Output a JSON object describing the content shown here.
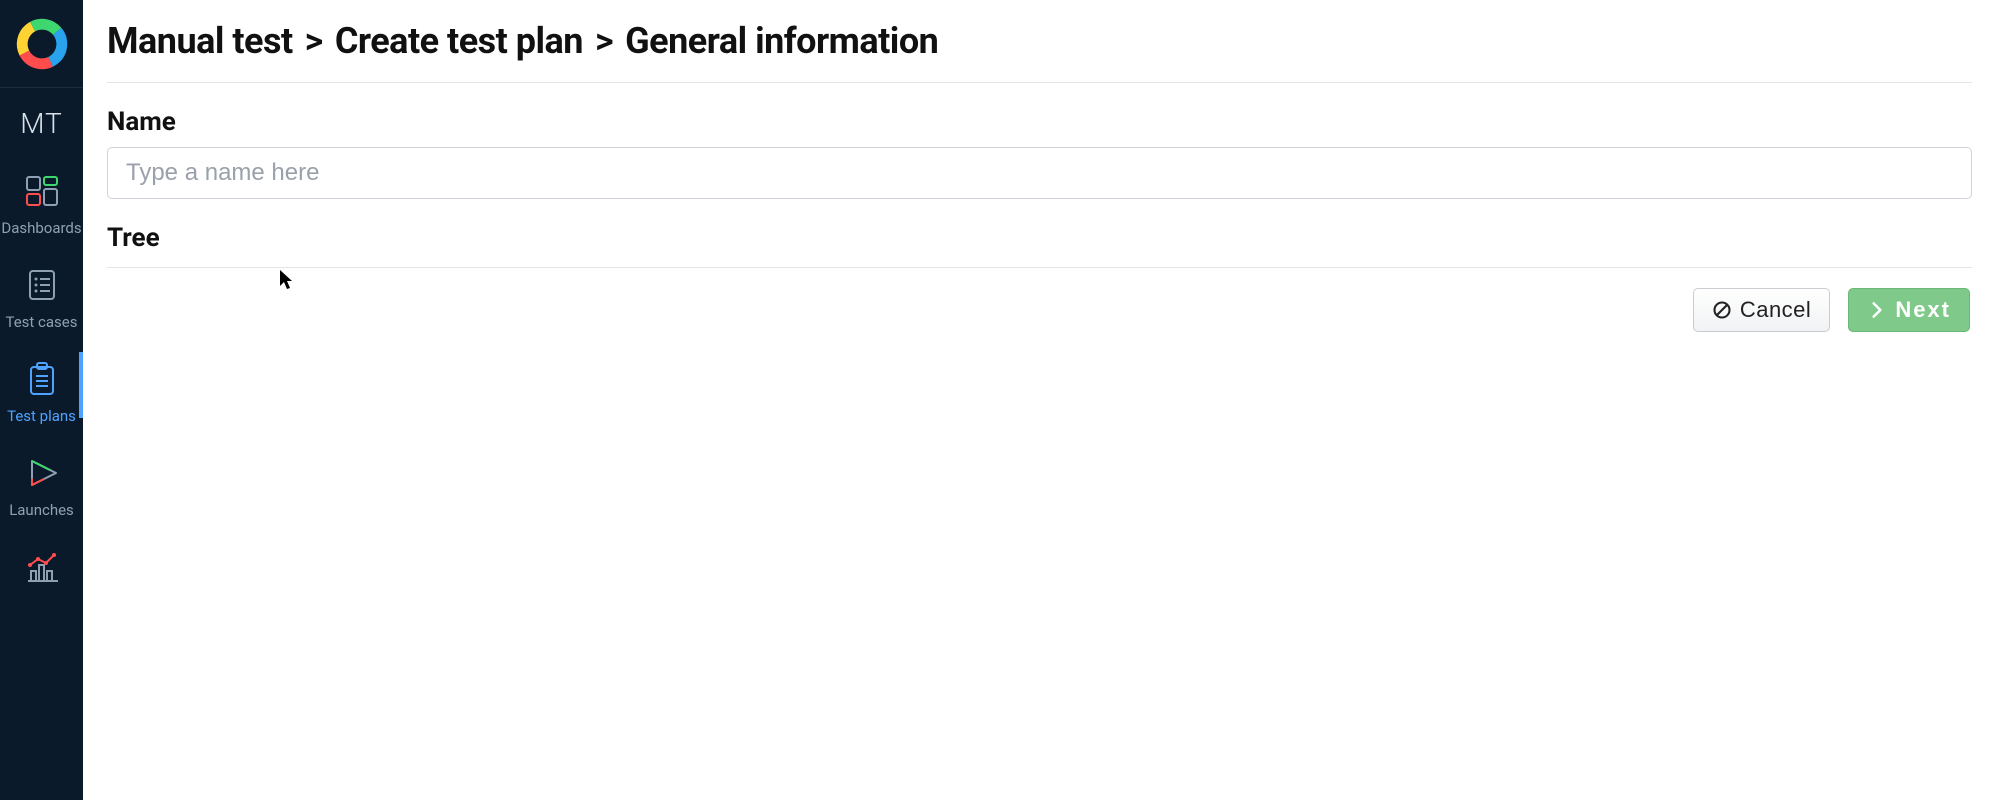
{
  "sidebar": {
    "project_code": "MT",
    "items": [
      {
        "label": "Dashboards"
      },
      {
        "label": "Test cases"
      },
      {
        "label": "Test plans"
      },
      {
        "label": "Launches"
      }
    ]
  },
  "breadcrumb": {
    "part1": "Manual test",
    "part2": "Create test plan",
    "part3": "General information",
    "separator": ">"
  },
  "form": {
    "name_label": "Name",
    "name_placeholder": "Type a name here",
    "name_value": "",
    "tree_label": "Tree"
  },
  "actions": {
    "cancel_label": "Cancel",
    "next_label": "Next"
  }
}
